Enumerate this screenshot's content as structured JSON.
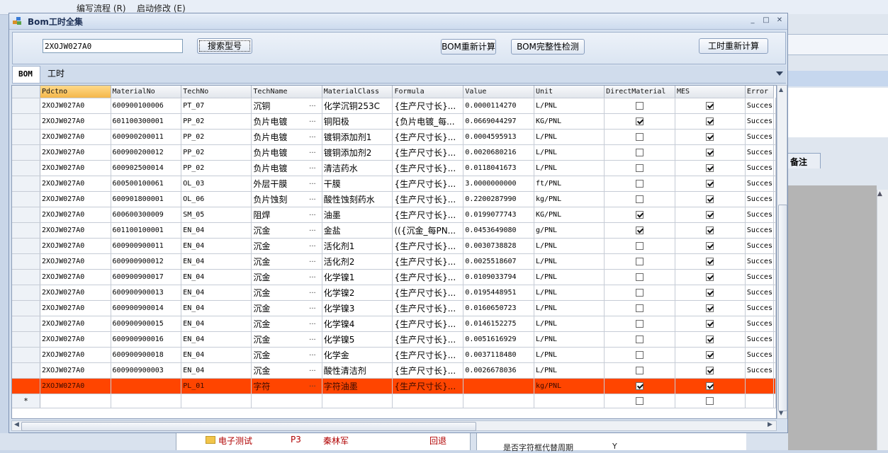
{
  "background": {
    "menu": [
      "编写流程 (R)",
      "启动修改 (E)"
    ],
    "right_tab_label": "备注",
    "tree_row": {
      "label": "电子测试",
      "code": "P3",
      "owner": "秦林军",
      "status": "回退"
    },
    "prop_row": {
      "label": "是否字符框代替周期",
      "value": "Y"
    }
  },
  "window": {
    "title": "Bom工时全集",
    "controls": [
      "_",
      "□",
      "✕"
    ]
  },
  "toolbar": {
    "model_value": "2XOJW027A0",
    "search_label": "搜索型号",
    "bom_recalc_label": "BOM重新计算",
    "bom_check_label": "BOM完整性检测",
    "hours_recalc_label": "工时重新计算"
  },
  "tabs": {
    "bom": "BOM",
    "hours": "工时"
  },
  "grid": {
    "columns": [
      "Pdctno",
      "MaterialNo",
      "TechNo",
      "TechName",
      "MaterialClass",
      "Formula",
      "Value",
      "Unit",
      "DirectMaterial",
      "MES",
      "Error"
    ],
    "rows": [
      {
        "pdctno": "2XOJW027A0",
        "material_no": "600900100006",
        "tech_no": "PT_07",
        "tech_name": "沉铜",
        "material_class": "化学沉铜253C",
        "formula": "{生产尺寸长}...",
        "value": "0.0000114270",
        "unit": "L/PNL",
        "direct": false,
        "mes": true,
        "error": "Succes"
      },
      {
        "pdctno": "2XOJW027A0",
        "material_no": "601100300001",
        "tech_no": "PP_02",
        "tech_name": "负片电镀",
        "material_class": "铜阳极",
        "formula": "{负片电镀_每...",
        "value": "0.0669044297",
        "unit": "KG/PNL",
        "direct": true,
        "mes": true,
        "error": "Succes"
      },
      {
        "pdctno": "2XOJW027A0",
        "material_no": "600900200011",
        "tech_no": "PP_02",
        "tech_name": "负片电镀",
        "material_class": "镀铜添加剂1",
        "formula": "{生产尺寸长}...",
        "value": "0.0004595913",
        "unit": "L/PNL",
        "direct": false,
        "mes": true,
        "error": "Succes"
      },
      {
        "pdctno": "2XOJW027A0",
        "material_no": "600900200012",
        "tech_no": "PP_02",
        "tech_name": "负片电镀",
        "material_class": "镀铜添加剂2",
        "formula": "{生产尺寸长}...",
        "value": "0.0020680216",
        "unit": "L/PNL",
        "direct": false,
        "mes": true,
        "error": "Succes"
      },
      {
        "pdctno": "2XOJW027A0",
        "material_no": "600902500014",
        "tech_no": "PP_02",
        "tech_name": "负片电镀",
        "material_class": "清洁药水",
        "formula": "{生产尺寸长}...",
        "value": "0.0118041673",
        "unit": "L/PNL",
        "direct": false,
        "mes": true,
        "error": "Succes"
      },
      {
        "pdctno": "2XOJW027A0",
        "material_no": "600500100061",
        "tech_no": "OL_03",
        "tech_name": "外层干膜",
        "material_class": "干膜",
        "formula": "{生产尺寸长}...",
        "value": "3.0000000000",
        "unit": "ft/PNL",
        "direct": false,
        "mes": true,
        "error": "Succes"
      },
      {
        "pdctno": "2XOJW027A0",
        "material_no": "600901800001",
        "tech_no": "OL_06",
        "tech_name": "负片蚀刻",
        "material_class": "酸性蚀刻药水",
        "formula": "{生产尺寸长}...",
        "value": "0.2200287990",
        "unit": "kg/PNL",
        "direct": false,
        "mes": true,
        "error": "Succes"
      },
      {
        "pdctno": "2XOJW027A0",
        "material_no": "600600300009",
        "tech_no": "SM_05",
        "tech_name": "阻焊",
        "material_class": "油墨",
        "formula": "{生产尺寸长}...",
        "value": "0.0199077743",
        "unit": "KG/PNL",
        "direct": true,
        "mes": true,
        "error": "Succes"
      },
      {
        "pdctno": "2XOJW027A0",
        "material_no": "601100100001",
        "tech_no": "EN_04",
        "tech_name": "沉金",
        "material_class": "金盐",
        "formula": "(({沉金_每PN...",
        "value": "0.0453649080",
        "unit": "g/PNL",
        "direct": true,
        "mes": true,
        "error": "Succes"
      },
      {
        "pdctno": "2XOJW027A0",
        "material_no": "600900900011",
        "tech_no": "EN_04",
        "tech_name": "沉金",
        "material_class": "活化剂1",
        "formula": "{生产尺寸长}...",
        "value": "0.0030738828",
        "unit": "L/PNL",
        "direct": false,
        "mes": true,
        "error": "Succes"
      },
      {
        "pdctno": "2XOJW027A0",
        "material_no": "600900900012",
        "tech_no": "EN_04",
        "tech_name": "沉金",
        "material_class": "活化剂2",
        "formula": "{生产尺寸长}...",
        "value": "0.0025518607",
        "unit": "L/PNL",
        "direct": false,
        "mes": true,
        "error": "Succes"
      },
      {
        "pdctno": "2XOJW027A0",
        "material_no": "600900900017",
        "tech_no": "EN_04",
        "tech_name": "沉金",
        "material_class": "化学镍1",
        "formula": "{生产尺寸长}...",
        "value": "0.0109033794",
        "unit": "L/PNL",
        "direct": false,
        "mes": true,
        "error": "Succes"
      },
      {
        "pdctno": "2XOJW027A0",
        "material_no": "600900900013",
        "tech_no": "EN_04",
        "tech_name": "沉金",
        "material_class": "化学镍2",
        "formula": "{生产尺寸长}...",
        "value": "0.0195448951",
        "unit": "L/PNL",
        "direct": false,
        "mes": true,
        "error": "Succes"
      },
      {
        "pdctno": "2XOJW027A0",
        "material_no": "600900900014",
        "tech_no": "EN_04",
        "tech_name": "沉金",
        "material_class": "化学镍3",
        "formula": "{生产尺寸长}...",
        "value": "0.0160650723",
        "unit": "L/PNL",
        "direct": false,
        "mes": true,
        "error": "Succes"
      },
      {
        "pdctno": "2XOJW027A0",
        "material_no": "600900900015",
        "tech_no": "EN_04",
        "tech_name": "沉金",
        "material_class": "化学镍4",
        "formula": "{生产尺寸长}...",
        "value": "0.0146152275",
        "unit": "L/PNL",
        "direct": false,
        "mes": true,
        "error": "Succes"
      },
      {
        "pdctno": "2XOJW027A0",
        "material_no": "600900900016",
        "tech_no": "EN_04",
        "tech_name": "沉金",
        "material_class": "化学镍5",
        "formula": "{生产尺寸长}...",
        "value": "0.0051616929",
        "unit": "L/PNL",
        "direct": false,
        "mes": true,
        "error": "Succes"
      },
      {
        "pdctno": "2XOJW027A0",
        "material_no": "600900900018",
        "tech_no": "EN_04",
        "tech_name": "沉金",
        "material_class": "化学金",
        "formula": "{生产尺寸长}...",
        "value": "0.0037118480",
        "unit": "L/PNL",
        "direct": false,
        "mes": true,
        "error": "Succes"
      },
      {
        "pdctno": "2XOJW027A0",
        "material_no": "600900900003",
        "tech_no": "EN_04",
        "tech_name": "沉金",
        "material_class": "酸性清洁剂",
        "formula": "{生产尺寸长}...",
        "value": "0.0026678036",
        "unit": "L/PNL",
        "direct": false,
        "mes": true,
        "error": "Succes"
      },
      {
        "pdctno": "2XOJW027A0",
        "material_no": "",
        "tech_no": "PL_01",
        "tech_name": "字符",
        "material_class": "字符油墨",
        "formula": "{生产尺寸长}...",
        "value": "",
        "unit": "kg/PNL",
        "direct": true,
        "mes": true,
        "error": "",
        "selected": true
      }
    ],
    "new_row_marker": "*",
    "tech_ellipsis": "..."
  },
  "colors": {
    "selected_row": "#ff4500",
    "header_active": "#f4b74a"
  }
}
